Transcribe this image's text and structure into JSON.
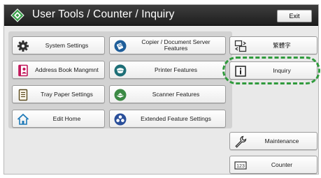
{
  "header": {
    "title": "User Tools / Counter / Inquiry",
    "exit_label": "Exit",
    "title_icon": "diamond-tools-icon"
  },
  "features": {
    "system_settings": "System Settings",
    "copier_document_server": "Copier / Document Server Features",
    "address_book": "Address Book Mangmnt",
    "printer_features": "Printer Features",
    "tray_paper_settings": "Tray Paper Settings",
    "scanner_features": "Scanner Features",
    "edit_home": "Edit Home",
    "extended_feature_settings": "Extended Feature Settings"
  },
  "side": {
    "language": "繁體字",
    "inquiry": "Inquiry",
    "maintenance": "Maintenance",
    "counter": "Counter"
  },
  "icons": {
    "system_settings": "gear-icon",
    "copier": "copier-icon",
    "address_book": "address-book-icon",
    "printer": "printer-icon",
    "tray_paper": "tray-paper-icon",
    "scanner": "scanner-icon",
    "edit_home": "home-icon",
    "extended": "extended-feature-icon",
    "language": "language-switch-icon",
    "inquiry": "info-icon",
    "maintenance": "wrench-icon",
    "counter": "counter-icon"
  },
  "colors": {
    "highlight": "#2f9a3c",
    "round_icon_blue": "#1f5e9a",
    "round_icon_teal": "#1e6f77",
    "round_icon_green": "#3c8a45",
    "round_icon_navy": "#2a4f9a"
  }
}
